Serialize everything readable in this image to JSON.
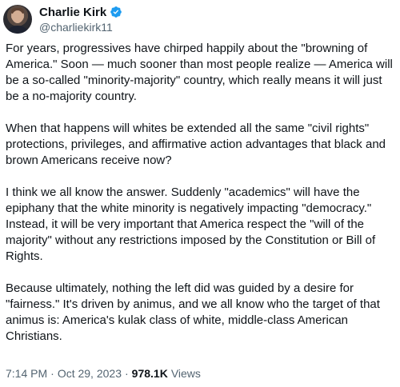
{
  "author": {
    "name": "Charlie Kirk",
    "handle": "@charliekirk11",
    "verified_icon": "verified-badge-icon",
    "verified_color": "#1d9bf0"
  },
  "tweet": {
    "paragraphs": [
      "For years, progressives have chirped happily about the \"browning of\nAmerica.\" Soon — much sooner than most people realize — America will\nbe a so-called \"minority-majority\" country, which really means it will just\nbe a no-majority country.",
      "When that happens will whites be extended all the same \"civil rights\"\nprotections, privileges, and affirmative action advantages that black and\nbrown Americans receive now?",
      "I think we all know the answer. Suddenly \"academics\" will have the\nepiphany that the white minority is negatively impacting \"democracy.\"\nInstead, it will be very important that America respect the \"will of the\nmajority\" without any restrictions imposed by the Constitution or Bill of\nRights.",
      "Because ultimately, nothing the left did was guided by a desire for\n\"fairness.\" It's driven by animus, and we all know who the target of that\nanimus is: America's kulak class of white, middle-class American\nChristians."
    ],
    "time": "7:14 PM",
    "separator": "·",
    "date": "Oct 29, 2023",
    "views_count": "978.1K",
    "views_label": "Views"
  },
  "colors": {
    "text": "#0f1419",
    "secondary_text": "#536471",
    "background": "#ffffff"
  }
}
